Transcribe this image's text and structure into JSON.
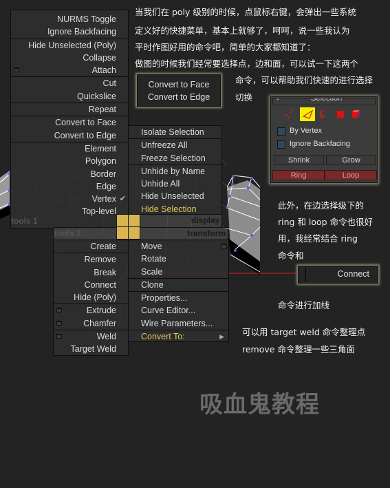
{
  "colors": {
    "background": "#232323",
    "highlight": "#e2c85a",
    "quad_yellow": "#d8b552",
    "red_button": "#7a2828",
    "annotation_line": "#b62025"
  },
  "quad_tools1": {
    "label": "tools 1",
    "items": [
      {
        "label": "NURMS Toggle"
      },
      {
        "label": "Ignore Backfacing"
      },
      {
        "label": "Hide Unselected (Poly)"
      },
      {
        "label": "Collapse"
      },
      {
        "label": "Attach",
        "icon": "settings-box-icon"
      },
      {
        "label": "Cut"
      },
      {
        "label": "Quickslice"
      },
      {
        "label": "Repeat"
      },
      {
        "label": "Convert to Face"
      },
      {
        "label": "Convert to Edge"
      },
      {
        "label": "Element"
      },
      {
        "label": "Polygon"
      },
      {
        "label": "Border"
      },
      {
        "label": "Edge"
      },
      {
        "label": "Vertex",
        "checked": true
      },
      {
        "label": "Top-level"
      }
    ]
  },
  "quad_display": {
    "label": "display",
    "items": [
      {
        "label": "Isolate Selection"
      },
      {
        "label": "Unfreeze All"
      },
      {
        "label": "Freeze Selection"
      },
      {
        "label": "Unhide by Name"
      },
      {
        "label": "Unhide All"
      },
      {
        "label": "Hide Unselected"
      },
      {
        "label": "Hide Selection",
        "highlighted": true
      }
    ]
  },
  "quad_tools2": {
    "label": "tools 2",
    "items": [
      {
        "label": "Create"
      },
      {
        "label": "Remove"
      },
      {
        "label": "Break"
      },
      {
        "label": "Connect"
      },
      {
        "label": "Hide (Poly)"
      },
      {
        "label": "Extrude",
        "icon": "settings-box-icon"
      },
      {
        "label": "Chamfer",
        "icon": "settings-box-icon"
      },
      {
        "label": "Weld",
        "icon": "settings-box-icon"
      },
      {
        "label": "Target Weld"
      }
    ]
  },
  "quad_transform": {
    "label": "transform",
    "items": [
      {
        "label": "Move"
      },
      {
        "label": "Rotate"
      },
      {
        "label": "Scale"
      },
      {
        "label": "Clone"
      },
      {
        "label": "Properties..."
      },
      {
        "label": "Curve Editor..."
      },
      {
        "label": "Wire Parameters..."
      },
      {
        "label": "Convert To:",
        "highlighted": true,
        "submenu": true
      }
    ]
  },
  "convert_popup": {
    "items": [
      "Convert to Face",
      "Convert to Edge"
    ]
  },
  "selection_panel": {
    "title": "Selection",
    "collapse": "-",
    "subobject_icons": [
      "vertex-icon",
      "edge-icon",
      "border-icon",
      "polygon-icon",
      "element-icon"
    ],
    "active_icon": "edge-icon",
    "checkboxes": [
      {
        "label": "By Vertex",
        "checked": false
      },
      {
        "label": "Ignore Backfacing",
        "checked": false
      }
    ],
    "buttons": {
      "shrink": "Shrink",
      "grow": "Grow",
      "ring": "Ring",
      "loop": "Loop"
    }
  },
  "connect_button": {
    "label": "Connect"
  },
  "text": {
    "intro_1": "当我们在 poly 级别的时候，点鼠标右键，会弹出一些系统",
    "intro_2": "定义好的快捷菜单，基本上就够了，呵呵，说一些我认为",
    "intro_3": "平时作图好用的命令吧，简单的大家都知道了：",
    "intro_4": "做图的时候我们经常要选择点，边和面，可以试一下这两个",
    "intro_5": "命令，可以帮助我们快速的进行选择",
    "intro_6": "切换",
    "ring_1": "此外，在边选择级下的",
    "ring_2": "ring 和 loop 命令也很好",
    "ring_3": "用，我经常结合 ring",
    "ring_4": "命令和",
    "ring_5": "命令进行加线",
    "weld_1": "可以用 target weld 命令整理点",
    "weld_2": "remove 命令整理一些三角面",
    "watermark": "吸血鬼教程"
  }
}
